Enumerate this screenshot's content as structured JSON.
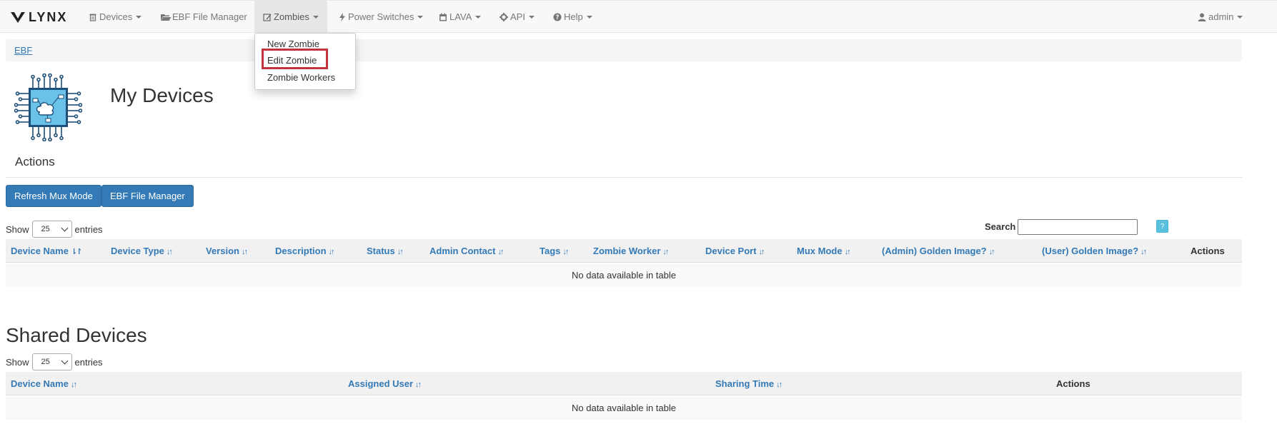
{
  "navbar": {
    "brand": "LYNX",
    "items": [
      {
        "label": "Devices",
        "icon": "trash-icon",
        "dropdown": true
      },
      {
        "label": "EBF File Manager",
        "icon": "folder-open-icon",
        "dropdown": false
      },
      {
        "label": "Zombies",
        "icon": "edit-icon",
        "dropdown": true,
        "open": true
      },
      {
        "label": "Power Switches",
        "icon": "flash-icon",
        "dropdown": true
      },
      {
        "label": "LAVA",
        "icon": "calendar-icon",
        "dropdown": true
      },
      {
        "label": "API",
        "icon": "cog-icon",
        "dropdown": true
      },
      {
        "label": "Help",
        "icon": "question-circle-icon",
        "dropdown": true
      }
    ],
    "user": "admin"
  },
  "zombies_menu": [
    "New Zombie",
    "Edit Zombie",
    "Zombie Workers"
  ],
  "breadcrumb": "EBF",
  "page_title": "My Devices",
  "actions_heading": "Actions",
  "buttons": {
    "refresh": "Refresh Mux Mode",
    "ebf": "EBF File Manager"
  },
  "my_devices": {
    "show_label": "Show",
    "length": "25",
    "entries_label": "entries",
    "search_label": "Search",
    "search_value": "",
    "help": "?",
    "columns": [
      "Device Name",
      "Device Type",
      "Version",
      "Description",
      "Status",
      "Admin Contact",
      "Tags",
      "Zombie Worker",
      "Device Port",
      "Mux Mode",
      "(Admin) Golden Image?",
      "(User) Golden Image?",
      "Actions"
    ],
    "empty": "No data available in table"
  },
  "shared_devices": {
    "title": "Shared Devices",
    "show_label": "Show",
    "length": "25",
    "entries_label": "entries",
    "columns": [
      "Device Name",
      "Assigned User",
      "Sharing Time",
      "Actions"
    ],
    "empty": "No data available in table"
  },
  "colors": {
    "primary": "#337ab7",
    "highlight": "#c0343b",
    "info": "#5bc0de"
  }
}
